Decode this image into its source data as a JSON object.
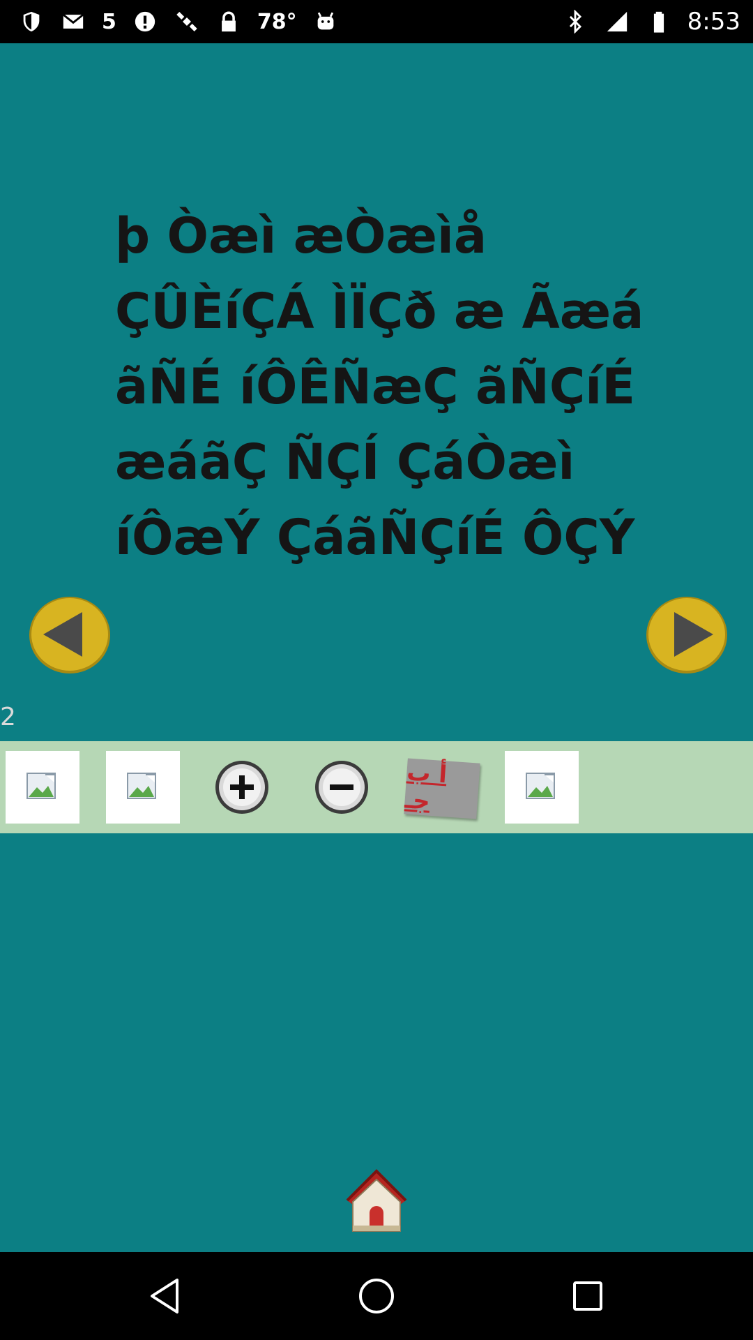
{
  "status_bar": {
    "badge_number": "5",
    "temperature": "78°",
    "time": "8:53",
    "icons": [
      "shield-icon",
      "mail-icon",
      "five-icon",
      "alert-icon",
      "satellite-icon",
      "lock-icon",
      "temperature",
      "android-icon",
      "bluetooth-icon",
      "signal-icon",
      "battery-icon"
    ]
  },
  "passage": {
    "lines": [
      "þ Òæì æÒæìå",
      "ÇÛÈíÇÁ ÌÏÇð æ Ãæá",
      "ãÑÉ íÔÊÑæÇ ãÑÇíÉ",
      "æáãÇ ÑÇÍ ÇáÒæì",
      "íÔæÝ ÇáãÑÇíÉ ÔÇÝ"
    ]
  },
  "page": {
    "number": "2"
  },
  "toolbar": {
    "abc_label": "أ ب جـ"
  },
  "colors": {
    "background": "#0c7f84",
    "toolbar": "#b6d7b5",
    "nav_button": "#d8b421",
    "text": "#151515"
  }
}
